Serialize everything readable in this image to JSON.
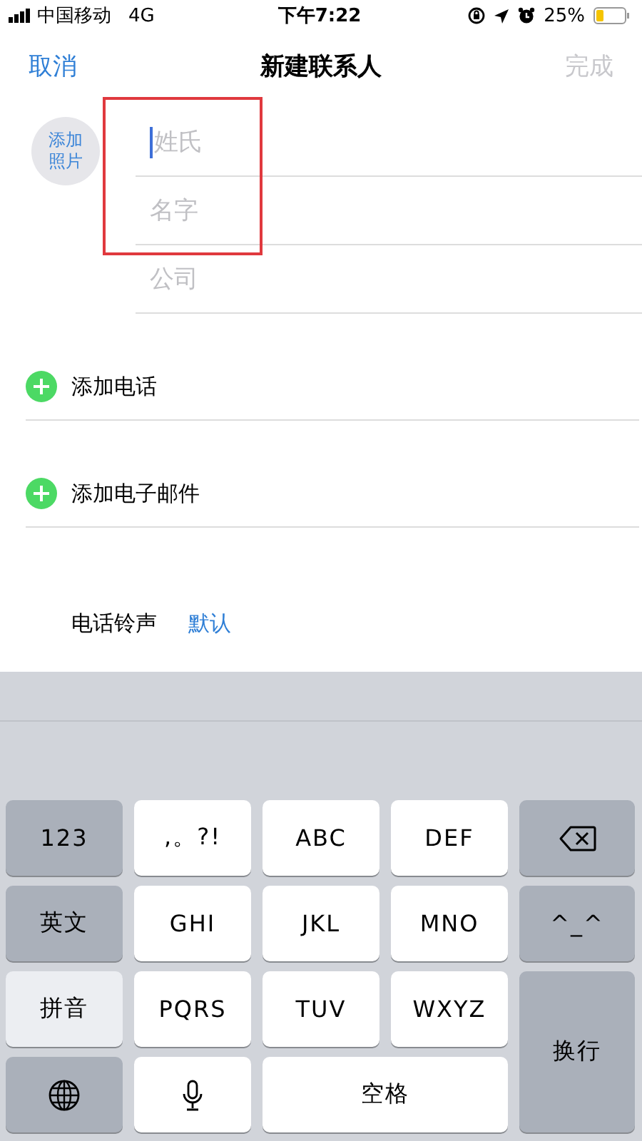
{
  "status_bar": {
    "carrier": "中国移动",
    "network": "4G",
    "time": "下午7:22",
    "battery": "25%"
  },
  "nav": {
    "cancel": "取消",
    "title": "新建联系人",
    "done": "完成",
    "done_disabled": true
  },
  "photo": {
    "label": "添加照片"
  },
  "fields": [
    {
      "placeholder": "姓氏",
      "focused": true
    },
    {
      "placeholder": "名字",
      "focused": false
    },
    {
      "placeholder": "公司",
      "focused": false
    }
  ],
  "highlight": {
    "color": "#e0393e"
  },
  "add_rows": [
    {
      "label": "添加电话"
    },
    {
      "label": "添加电子邮件"
    }
  ],
  "ringtone": {
    "label": "电话铃声",
    "value": "默认"
  },
  "keyboard": {
    "keys": [
      {
        "label": "123",
        "kind": "function"
      },
      {
        "label": ",。?!",
        "kind": "letter"
      },
      {
        "label": "ABC",
        "kind": "letter"
      },
      {
        "label": "DEF",
        "kind": "letter"
      },
      {
        "kind": "delete"
      },
      {
        "label": "英文",
        "kind": "mode",
        "selected": false
      },
      {
        "label": "GHI",
        "kind": "letter"
      },
      {
        "label": "JKL",
        "kind": "letter"
      },
      {
        "label": "MNO",
        "kind": "letter"
      },
      {
        "label": "^_^",
        "kind": "function"
      },
      {
        "label": "拼音",
        "kind": "mode",
        "selected": true
      },
      {
        "label": "PQRS",
        "kind": "letter"
      },
      {
        "label": "TUV",
        "kind": "letter"
      },
      {
        "label": "WXYZ",
        "kind": "letter"
      },
      {
        "label": "换行",
        "kind": "return"
      },
      {
        "kind": "globe"
      },
      {
        "kind": "mic"
      },
      {
        "label": "空格",
        "kind": "space"
      }
    ]
  }
}
